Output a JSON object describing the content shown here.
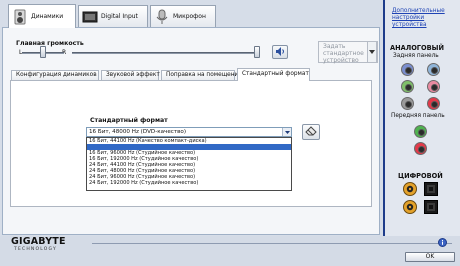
{
  "tabs": [
    {
      "label": "Динамики",
      "icon": "speaker-icon",
      "active": true
    },
    {
      "label": "Digital Input",
      "icon": "digital-input-icon",
      "active": false
    },
    {
      "label": "Микрофон",
      "icon": "microphone-icon",
      "active": false
    }
  ],
  "advanced_link": "Дополнительные настройки устройства",
  "volume": {
    "label": "Главная громкость",
    "left": "L",
    "right": "R",
    "level": 0.97,
    "balance": 0.5
  },
  "set_default": {
    "label": "Задать стандартное устройство"
  },
  "inner_tabs": [
    {
      "label": "Конфигурация динамиков",
      "active": false
    },
    {
      "label": "Звуковой эффект",
      "active": false
    },
    {
      "label": "Поправка на помещение",
      "active": false
    },
    {
      "label": "Стандартный формат",
      "active": true
    }
  ],
  "format": {
    "label": "Стандартный формат",
    "selected": "16 Бит, 48000 Hz (DVD-качество)",
    "options": [
      "16 Бит, 44100 Hz (Качество компакт-диска)",
      "16 Бит, 48000 Hz (DVD-качество)",
      "16 Бит, 96000 Hz (Студийное качество)",
      "16 Бит, 192000 Hz (Студийное качество)",
      "24 Бит, 44100 Hz (Студийное качество)",
      "24 Бит, 48000 Hz (Студийное качество)",
      "24 Бит, 96000 Hz (Студийное качество)",
      "24 Бит, 192000 Hz (Студийное качество)"
    ],
    "highlighted_index": 1
  },
  "right_panel": {
    "analog_title": "АНАЛОГОВЫЙ",
    "back_panel_label": "Задняя панель",
    "front_panel_label": "Передняя панель",
    "digital_title": "ЦИФРОВОЙ",
    "back_jacks": [
      "#7a8ecf",
      "#8fb4d8",
      "#7fbf6a",
      "#e88aa0",
      "#9a9a9a",
      "#e23a4a"
    ],
    "front_jacks": [
      "#4fb24f",
      "#e23a4a"
    ]
  },
  "brand": {
    "name": "GIGABYTE",
    "sub": "TECHNOLOGY"
  },
  "ok_label": "OK",
  "colors": {
    "accent": "#1e3c8a",
    "selection": "#3169c6"
  }
}
